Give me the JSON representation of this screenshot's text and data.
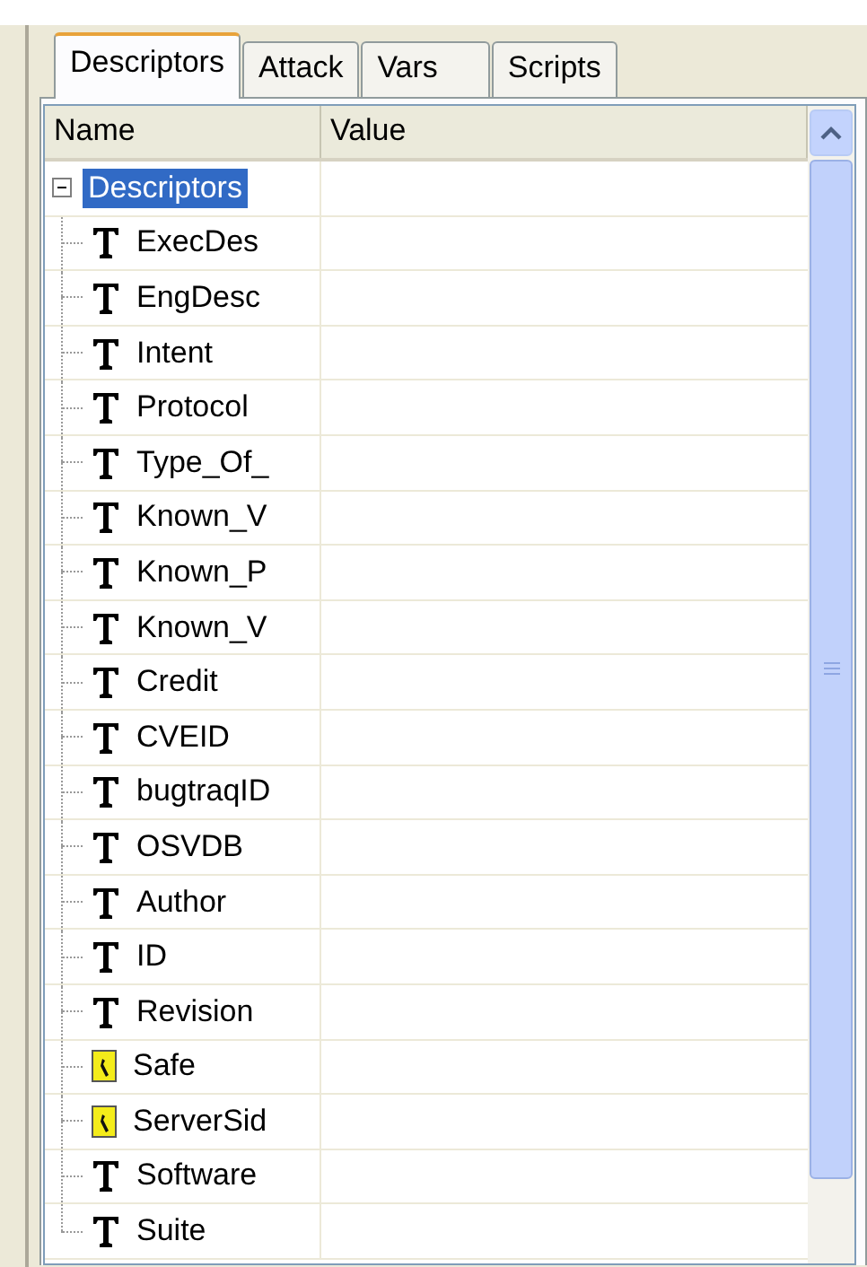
{
  "tabs": [
    {
      "label": "Descriptors",
      "selected": true
    },
    {
      "label": "Attack",
      "selected": false
    },
    {
      "label": "Vars",
      "selected": false
    },
    {
      "label": "Scripts",
      "selected": false
    }
  ],
  "grid": {
    "columns": [
      "Name",
      "Value"
    ],
    "root": {
      "label": "Descriptors",
      "selected": true,
      "expanded": true,
      "children": [
        {
          "label": "ExecDes",
          "kind": "text"
        },
        {
          "label": "EngDesc",
          "kind": "text"
        },
        {
          "label": "Intent",
          "kind": "text"
        },
        {
          "label": "Protocol",
          "kind": "text"
        },
        {
          "label": "Type_Of_",
          "kind": "text"
        },
        {
          "label": "Known_V",
          "kind": "text"
        },
        {
          "label": "Known_P",
          "kind": "text"
        },
        {
          "label": "Known_V",
          "kind": "text"
        },
        {
          "label": "Credit",
          "kind": "text"
        },
        {
          "label": "CVEID",
          "kind": "text"
        },
        {
          "label": "bugtraqID",
          "kind": "text"
        },
        {
          "label": "OSVDB",
          "kind": "text"
        },
        {
          "label": "Author",
          "kind": "text"
        },
        {
          "label": "ID",
          "kind": "text"
        },
        {
          "label": "Revision",
          "kind": "text"
        },
        {
          "label": "Safe",
          "kind": "bool"
        },
        {
          "label": "ServerSid",
          "kind": "bool"
        },
        {
          "label": "Software",
          "kind": "text"
        },
        {
          "label": "Suite",
          "kind": "text"
        }
      ]
    }
  }
}
